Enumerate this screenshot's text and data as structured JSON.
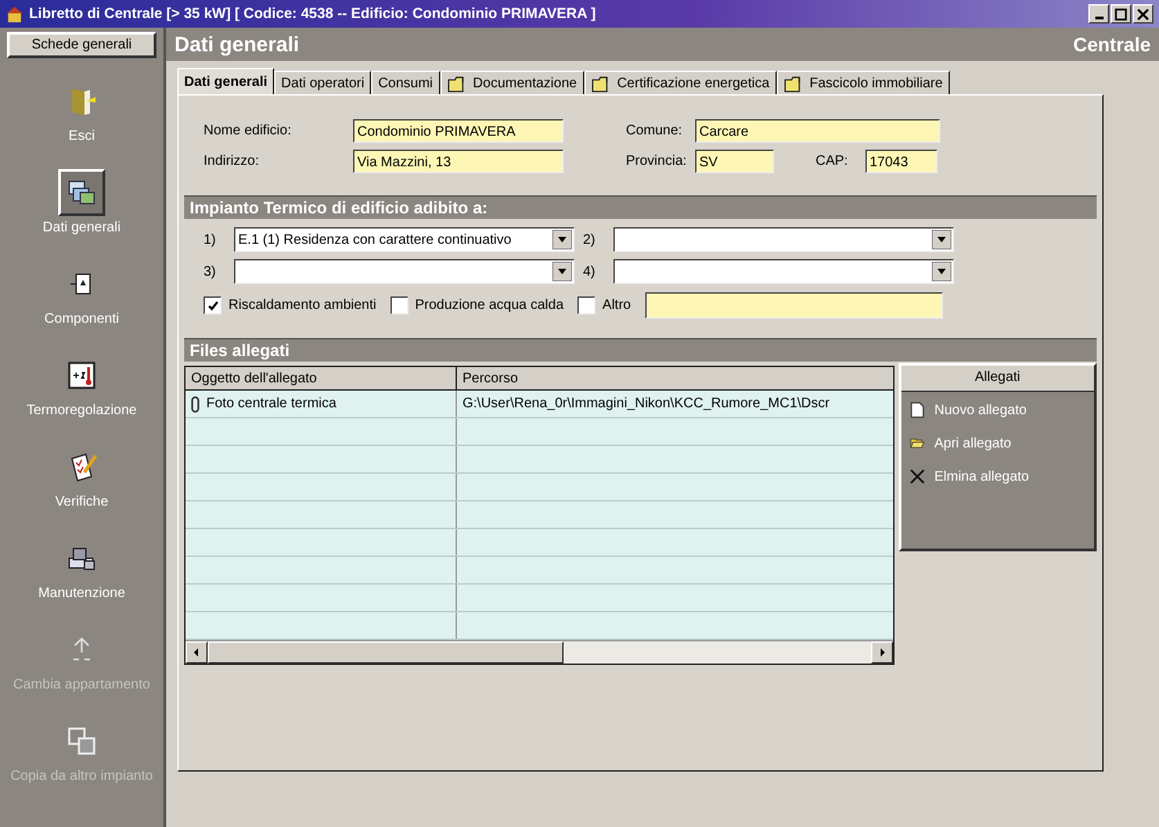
{
  "window": {
    "title": "Libretto di Centrale [> 35 kW] [ Codice: 4538 -- Edificio: Condominio PRIMAVERA ]"
  },
  "sidebar": {
    "button": "Schede generali",
    "items": [
      {
        "label": "Esci",
        "kind": "door",
        "selected": false,
        "disabled": false
      },
      {
        "label": "Dati generali",
        "kind": "folders",
        "selected": true,
        "disabled": false
      },
      {
        "label": "Componenti",
        "kind": "component",
        "selected": false,
        "disabled": false
      },
      {
        "label": "Termoregolazione",
        "kind": "thermo",
        "selected": false,
        "disabled": false
      },
      {
        "label": "Verifiche",
        "kind": "check",
        "selected": false,
        "disabled": false
      },
      {
        "label": "Manutenzione",
        "kind": "machine",
        "selected": false,
        "disabled": false
      },
      {
        "label": "Cambia appartamento",
        "kind": "switch",
        "selected": false,
        "disabled": true
      },
      {
        "label": "Copia da altro impianto",
        "kind": "copy",
        "selected": false,
        "disabled": true
      }
    ]
  },
  "header": {
    "title": "Dati generali",
    "context": "Centrale"
  },
  "tabs": [
    {
      "label": "Dati generali",
      "kind": "plain",
      "selected": true
    },
    {
      "label": "Dati operatori",
      "kind": "plain",
      "selected": false
    },
    {
      "label": "Consumi",
      "kind": "plain",
      "selected": false
    },
    {
      "label": "Documentazione",
      "kind": "folder",
      "selected": false
    },
    {
      "label": "Certificazione energetica",
      "kind": "folder",
      "selected": false
    },
    {
      "label": "Fascicolo immobiliare",
      "kind": "folder",
      "selected": false
    }
  ],
  "fields": [
    {
      "label": "Nome edificio:",
      "value": "Condominio PRIMAVERA"
    },
    {
      "label": "Comune:",
      "value": "Carcare"
    },
    {
      "label": "Indirizzo:",
      "value": "Via Mazzini, 13"
    },
    {
      "label": "Provincia:",
      "value": "SV"
    },
    {
      "label": "CAP:",
      "value": "17043"
    }
  ],
  "impianto": {
    "title": "Impianto Termico di edificio adibito a:",
    "selects": [
      {
        "label": "1)",
        "value": "E.1 (1) Residenza con carattere continuativo"
      },
      {
        "label": "2)"
      },
      {
        "label": "3)"
      },
      {
        "label": "4)"
      }
    ],
    "checks": [
      {
        "label": "Riscaldamento ambienti",
        "checked": true
      },
      {
        "label": "Produzione acqua calda",
        "checked": false
      },
      {
        "label": "Altro",
        "checked": false
      }
    ]
  },
  "files": {
    "title": "Files allegati",
    "columns": [
      "Oggetto dell'allegato",
      "Percorso"
    ],
    "rows": [
      {
        "oggetto": "Foto centrale termica",
        "percorso": "G:\\User\\Rena_0r\\Immagini_Nikon\\KCC_Rumore_MC1\\Dscr"
      }
    ],
    "panel_title": "Allegati",
    "actions": [
      {
        "label": "Nuovo allegato",
        "kind": "new"
      },
      {
        "label": "Apri allegato",
        "kind": "open"
      },
      {
        "label": "Elmina allegato",
        "kind": "delete"
      }
    ]
  }
}
